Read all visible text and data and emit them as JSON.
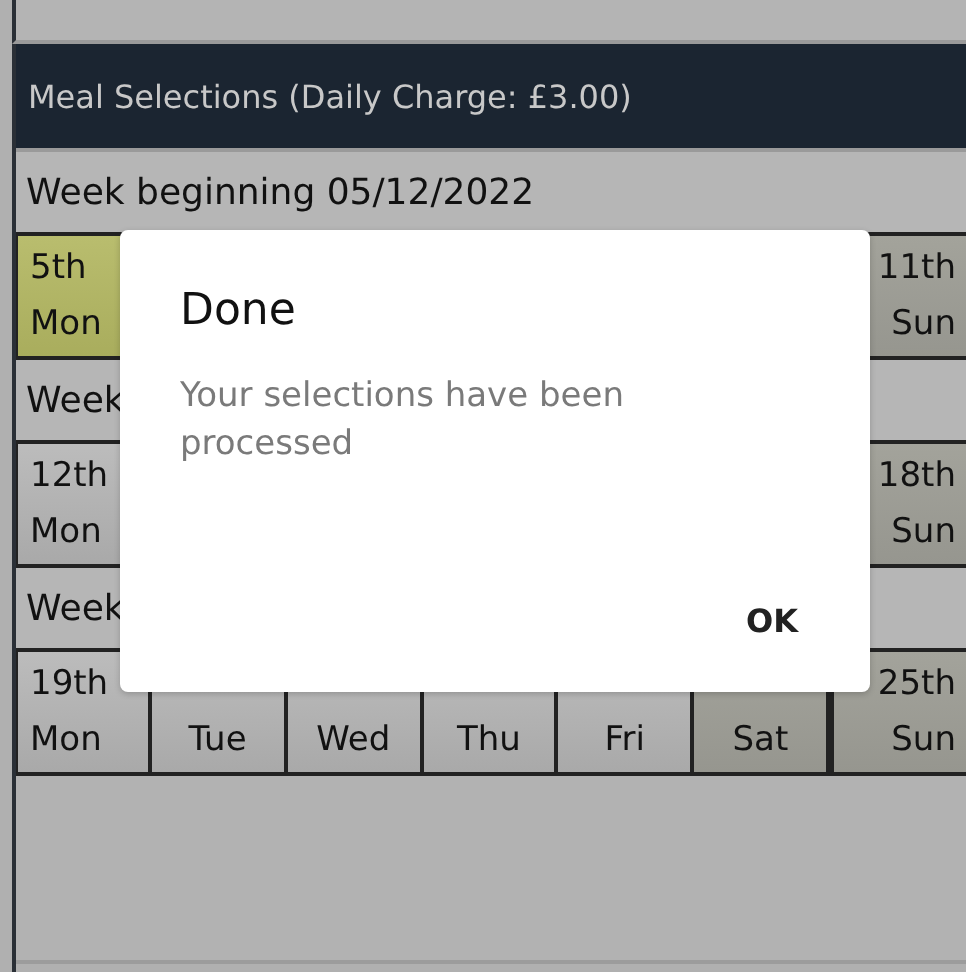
{
  "header": {
    "title": "Meal Selections (Daily Charge: £3.00)"
  },
  "weeks": [
    {
      "title": "Week beginning 05/12/2022",
      "days": [
        {
          "kind": "weekday",
          "selected": true,
          "date": "5th",
          "day": "Mon"
        },
        {
          "kind": "weekend",
          "selected": false,
          "date": "11th",
          "day": "Sun"
        }
      ]
    },
    {
      "title": "Week",
      "days": [
        {
          "kind": "weekday",
          "selected": false,
          "date": "12th",
          "day": "Mon"
        },
        {
          "kind": "weekend",
          "selected": false,
          "date": "18th",
          "day": "Sun"
        }
      ]
    },
    {
      "title": "Week",
      "days": [
        {
          "kind": "weekday",
          "selected": false,
          "date": "19th",
          "day": "Mon"
        },
        {
          "kind": "weekday",
          "selected": false,
          "day": "Tue"
        },
        {
          "kind": "weekday",
          "selected": false,
          "day": "Wed"
        },
        {
          "kind": "weekday",
          "selected": false,
          "day": "Thu"
        },
        {
          "kind": "weekday",
          "selected": false,
          "day": "Fri"
        },
        {
          "kind": "weekend",
          "selected": false,
          "day": "Sat"
        },
        {
          "kind": "weekend",
          "selected": false,
          "date": "25th",
          "day": "Sun"
        }
      ]
    }
  ],
  "dialog": {
    "title": "Done",
    "message": "Your selections have been processed",
    "button": "OK"
  }
}
